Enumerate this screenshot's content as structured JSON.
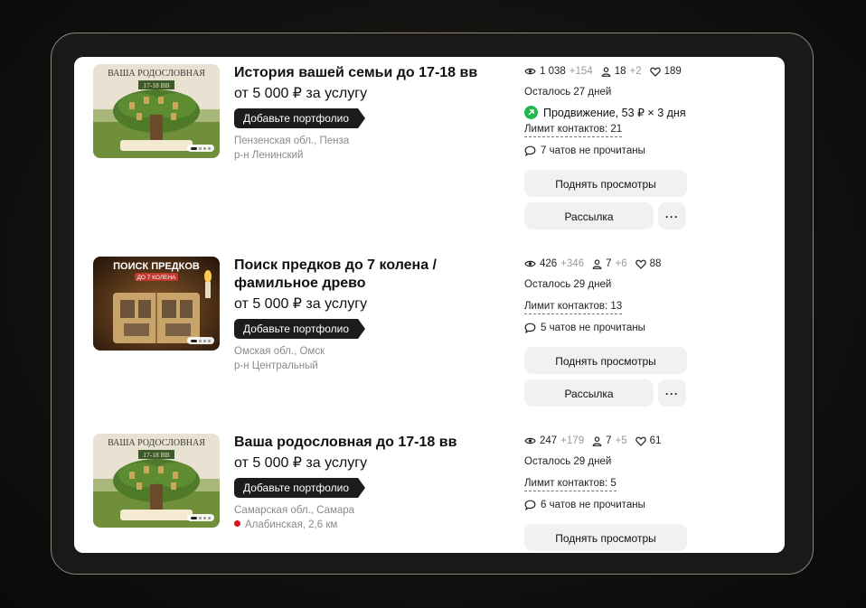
{
  "listings": [
    {
      "thumb_text": "ВАША РОДОСЛОВНАЯ",
      "thumb_sub": "17-18 ВВ",
      "title_lines": [
        "История вашей семьи до 17-18 вв"
      ],
      "price": "от 5 000 ₽ за услугу",
      "tag": "Добавьте портфолио",
      "loc1": "Пензенская обл., Пенза",
      "loc2": "р-н Ленинский",
      "views": "1 038",
      "views_delta": "+154",
      "fav": "18",
      "fav_delta": "+2",
      "likes": "189",
      "remaining": "Осталось 27 дней",
      "promo": "Продвижение, 53 ₽ × 3 дня",
      "limit": "Лимит контактов: 21",
      "chats": "7 чатов не прочитаны",
      "btn_raise": "Поднять просмотры",
      "btn_mail": "Рассылка",
      "btn_more": "···"
    },
    {
      "thumb_text": "ПОИСК ПРЕДКОВ",
      "thumb_sub": "ДО 7 КОЛЕНА",
      "title_lines": [
        "Поиск предков до 7 колена /",
        "фамильное древо"
      ],
      "price": "от 5 000 ₽ за услугу",
      "tag": "Добавьте портфолио",
      "loc1": "Омская обл., Омск",
      "loc2": "р-н Центральный",
      "views": "426",
      "views_delta": "+346",
      "fav": "7",
      "fav_delta": "+6",
      "likes": "88",
      "remaining": "Осталось 29 дней",
      "limit": "Лимит контактов: 13",
      "chats": "5 чатов не прочитаны",
      "btn_raise": "Поднять просмотры",
      "btn_mail": "Рассылка",
      "btn_more": "···"
    },
    {
      "thumb_text": "ВАША РОДОСЛОВНАЯ",
      "thumb_sub": "17-18 ВВ",
      "title_lines": [
        "Ваша родословная до 17-18 вв"
      ],
      "price": "от 5 000 ₽ за услугу",
      "tag": "Добавьте портфолио",
      "loc1": "Самарская обл., Самара",
      "loc2": "Алабинская, 2,6 км",
      "views": "247",
      "views_delta": "+179",
      "fav": "7",
      "fav_delta": "+5",
      "likes": "61",
      "remaining": "Осталось 29 дней",
      "limit": "Лимит контактов: 5",
      "chats": "6 чатов не прочитаны",
      "btn_raise": "Поднять просмотры"
    }
  ],
  "icons": {
    "views": "eye-icon",
    "favorites": "person-icon",
    "likes": "heart-icon",
    "chats": "chat-bubble-icon",
    "promo": "arrow-up-right-icon"
  },
  "colors": {
    "accent_green": "#1fb84e",
    "tag_bg": "#1c1c1c",
    "button_bg": "#f2f1ef",
    "metro_red": "#d7141a"
  }
}
